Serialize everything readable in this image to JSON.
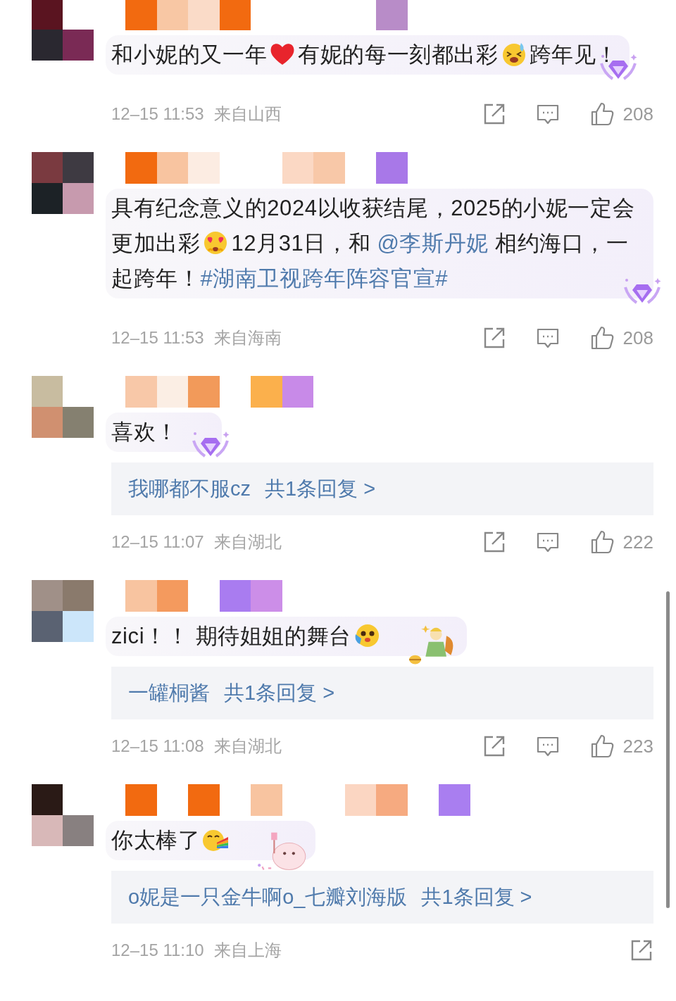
{
  "comments": [
    {
      "avatar": {
        "kind": "mosaic"
      },
      "author": {
        "kind": "mosaic"
      },
      "text": [
        {
          "kind": "text",
          "text": "和小妮的又一年"
        },
        {
          "kind": "emoji"
        },
        {
          "kind": "text",
          "text": "有妮的每一刻都出彩"
        },
        {
          "kind": "emoji"
        },
        {
          "kind": "text",
          "text": "跨年见！"
        }
      ],
      "decoration": {
        "kind": "badge"
      },
      "time": "12–15 11:53",
      "location": "来自山西",
      "actions": [
        {
          "kind": "share"
        },
        {
          "kind": "comment"
        },
        {
          "kind": "like",
          "count": "208"
        }
      ]
    },
    {
      "avatar": {
        "kind": "mosaic"
      },
      "author": {
        "kind": "mosaic"
      },
      "text": [
        {
          "kind": "text",
          "text": "具有纪念意义的2024以收获结尾，2025的小妮一定会更加出彩"
        },
        {
          "kind": "emoji"
        },
        {
          "kind": "text",
          "text": "12月31日，和 "
        },
        {
          "kind": "mention",
          "text": "@李斯丹妮"
        },
        {
          "kind": "text",
          "text": " 相约海口，一起跨年！"
        },
        {
          "kind": "hashtag",
          "text": "#湖南卫视跨年阵容官宣#"
        }
      ],
      "decoration": {
        "kind": "badge"
      },
      "time": "12–15 11:53",
      "location": "来自海南",
      "actions": [
        {
          "kind": "share"
        },
        {
          "kind": "comment"
        },
        {
          "kind": "like",
          "count": "208"
        }
      ]
    },
    {
      "avatar": {
        "kind": "mosaic"
      },
      "author": {
        "kind": "mosaic"
      },
      "text": [
        {
          "kind": "text",
          "text": "喜欢！"
        }
      ],
      "decoration": {
        "kind": "badge"
      },
      "reply": {
        "author": "我哪都不服cz",
        "summary": "共1条回复 >"
      },
      "time": "12–15 11:07",
      "location": "来自湖北",
      "actions": [
        {
          "kind": "share"
        },
        {
          "kind": "comment"
        },
        {
          "kind": "like",
          "count": "222"
        }
      ]
    },
    {
      "avatar": {
        "kind": "mosaic"
      },
      "author": {
        "kind": "mosaic"
      },
      "text": [
        {
          "kind": "text",
          "text": "zici！！ 期待姐姐的舞台"
        },
        {
          "kind": "emoji"
        }
      ],
      "decoration": {
        "kind": "sticker"
      },
      "reply": {
        "author": "一罐桐酱",
        "summary": "共1条回复 >"
      },
      "time": "12–15 11:08",
      "location": "来自湖北",
      "actions": [
        {
          "kind": "share"
        },
        {
          "kind": "comment"
        },
        {
          "kind": "like",
          "count": "223"
        }
      ]
    },
    {
      "avatar": {
        "kind": "mosaic"
      },
      "author": {
        "kind": "mosaic"
      },
      "text": [
        {
          "kind": "text",
          "text": "你太棒了"
        },
        {
          "kind": "emoji"
        }
      ],
      "decoration": {
        "kind": "sticker"
      },
      "reply": {
        "author": "o妮是一只金牛啊o_七瓣刘海版",
        "summary": "共1条回复 >"
      },
      "time": "12–15 11:10",
      "location": "来自上海",
      "actions": [
        {
          "kind": "share"
        }
      ]
    }
  ]
}
